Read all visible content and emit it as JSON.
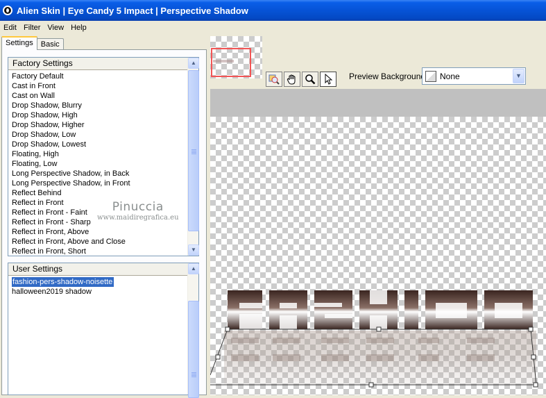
{
  "window": {
    "title": "Alien Skin | Eye Candy 5 Impact | Perspective Shadow"
  },
  "menu": [
    "Edit",
    "Filter",
    "View",
    "Help"
  ],
  "tabs": [
    {
      "label": "Settings",
      "active": true
    },
    {
      "label": "Basic",
      "active": false
    }
  ],
  "factory_settings": {
    "header": "Factory Settings",
    "items": [
      "Factory Default",
      "Cast in Front",
      "Cast on Wall",
      "Drop Shadow, Blurry",
      "Drop Shadow, High",
      "Drop Shadow, Higher",
      "Drop Shadow, Low",
      "Drop Shadow, Lowest",
      "Floating, High",
      "Floating, Low",
      "Long Perspective Shadow, in Back",
      "Long Perspective Shadow, in Front",
      "Reflect Behind",
      "Reflect in Front",
      "Reflect in Front - Faint",
      "Reflect in Front - Sharp",
      "Reflect in Front, Above",
      "Reflect in Front, Above and Close",
      "Reflect in Front, Short"
    ]
  },
  "user_settings": {
    "header": "User Settings",
    "items": [
      "fashion-pers-shadow-noisette",
      "halloween2019  shadow"
    ],
    "selected_index": 0
  },
  "watermark": {
    "line1": "Pinuccia",
    "line2": "www.maidiregrafica.eu"
  },
  "preview_background": {
    "label": "Preview Background:",
    "value": "None"
  },
  "tools": [
    "zoom-preview-icon",
    "hand-icon",
    "magnifier-icon",
    "arrow-pointer-icon"
  ],
  "colors": {
    "titlebar": "#0653d6",
    "selection": "#316ac5",
    "shadow_text": "#4a3328",
    "thumb_frame": "#f25555"
  }
}
